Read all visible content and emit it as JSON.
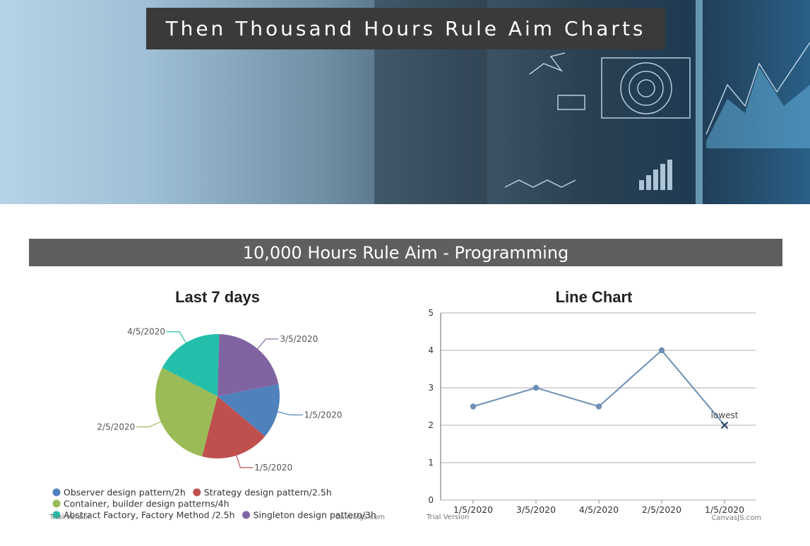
{
  "hero": {
    "title": "Then Thousand Hours Rule Aim Charts"
  },
  "section": {
    "title": "10,000 Hours Rule Aim - Programming"
  },
  "chart_data": [
    {
      "type": "pie",
      "title": "Last 7 days",
      "slices": [
        {
          "label": "1/5/2020",
          "legend": "Observer design pattern/2h",
          "value": 2,
          "color": "#4f81bc"
        },
        {
          "label": "1/5/2020",
          "legend": "Strategy design pattern/2.5h",
          "value": 2.5,
          "color": "#c0504e"
        },
        {
          "label": "2/5/2020",
          "legend": "Container, builder design patterns/4h",
          "value": 4,
          "color": "#9bbb58"
        },
        {
          "label": "4/5/2020",
          "legend": "Abstract Factory, Factory Method /2.5h",
          "value": 2.5,
          "color": "#23bfaa"
        },
        {
          "label": "3/5/2020",
          "legend": "Singleton design pattern/3h",
          "value": 3,
          "color": "#8064a1"
        }
      ],
      "legend_position": "bottom",
      "credit_left": "Trial Version",
      "credit_right": "CanvasJS.com"
    },
    {
      "type": "line",
      "title": "Line Chart",
      "categories": [
        "1/5/2020",
        "3/5/2020",
        "4/5/2020",
        "2/5/2020",
        "1/5/2020"
      ],
      "values": [
        2.5,
        3,
        2.5,
        4,
        2
      ],
      "ylim": [
        0,
        5
      ],
      "yticks": [
        0,
        1,
        2,
        3,
        4,
        5
      ],
      "grid": true,
      "annotation": {
        "index": 4,
        "text": "lowest",
        "marker": "cross"
      },
      "line_color": "#6d8fb5",
      "credit_left": "Trial Version",
      "credit_right": "CanvasJS.com"
    }
  ]
}
